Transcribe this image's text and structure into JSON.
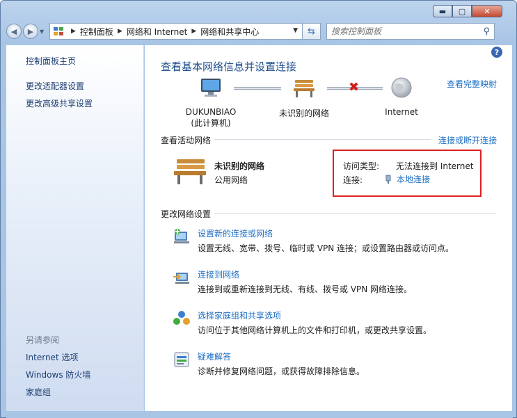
{
  "window": {
    "minimize": "▬",
    "maximize": "▢",
    "close": "✕"
  },
  "address_bar": {
    "crumbs": [
      "控制面板",
      "网络和 Internet",
      "网络和共享中心"
    ]
  },
  "search": {
    "placeholder": "搜索控制面板"
  },
  "sidebar": {
    "items": [
      {
        "label": "控制面板主页"
      },
      {
        "label": "更改适配器设置"
      },
      {
        "label": "更改高级共享设置"
      }
    ],
    "see_also_title": "另请参阅",
    "see_also": [
      {
        "label": "Internet 选项"
      },
      {
        "label": "Windows 防火墙"
      },
      {
        "label": "家庭组"
      }
    ]
  },
  "main": {
    "title": "查看基本网络信息并设置连接",
    "full_map_link": "查看完整映射",
    "nodes": {
      "computer_name": "DUKUNBIAO",
      "computer_sub": "(此计算机)",
      "network": "未识别的网络",
      "internet": "Internet"
    },
    "active_networks_header": "查看活动网络",
    "connect_disconnect_link": "连接或断开连接",
    "active_network": {
      "name": "未识别的网络",
      "type": "公用网络",
      "access_type_label": "访问类型:",
      "access_type_value": "无法连接到 Internet",
      "connection_label": "连接:",
      "connection_value": "本地连接"
    },
    "change_settings_header": "更改网络设置",
    "tasks": [
      {
        "link": "设置新的连接或网络",
        "desc": "设置无线、宽带、拨号、临时或 VPN 连接；或设置路由器或访问点。"
      },
      {
        "link": "连接到网络",
        "desc": "连接到或重新连接到无线、有线、拨号或 VPN 网络连接。"
      },
      {
        "link": "选择家庭组和共享选项",
        "desc": "访问位于其他网络计算机上的文件和打印机，或更改共享设置。"
      },
      {
        "link": "疑难解答",
        "desc": "诊断并修复网络问题，或获得故障排除信息。"
      }
    ]
  }
}
